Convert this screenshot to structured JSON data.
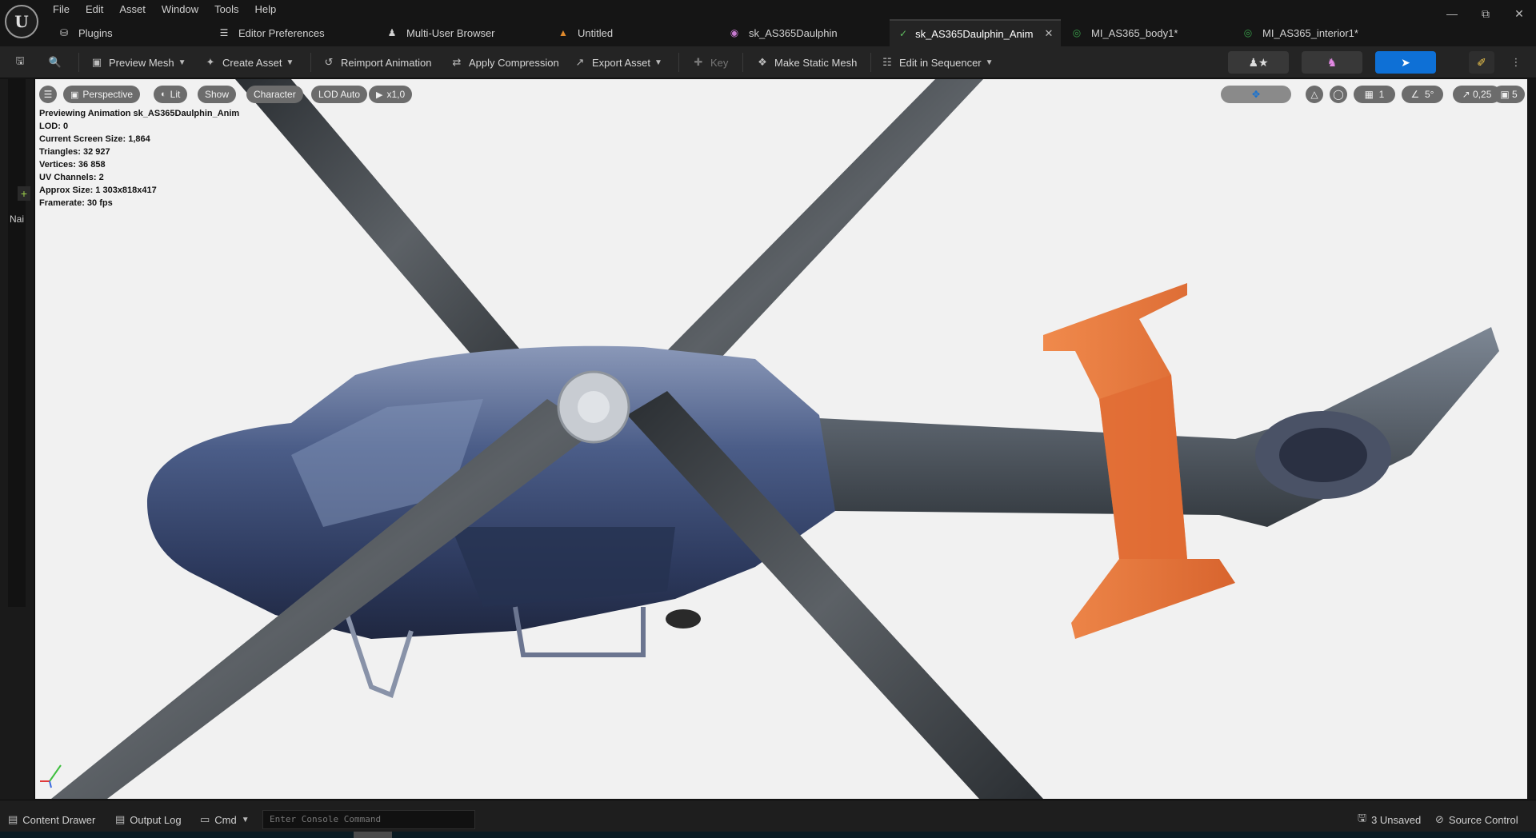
{
  "app": {
    "logo_text": "U",
    "menu": [
      "File",
      "Edit",
      "Asset",
      "Window",
      "Tools",
      "Help"
    ]
  },
  "tabs": [
    {
      "label": "Plugins",
      "icon": "plug-icon"
    },
    {
      "label": "Editor Preferences",
      "icon": "sliders-icon"
    },
    {
      "label": "Multi-User Browser",
      "icon": "users-icon"
    },
    {
      "label": "Untitled",
      "icon": "level-icon"
    },
    {
      "label": "sk_AS365Daulphin",
      "icon": "skeleton-icon"
    },
    {
      "label": "sk_AS365Daulphin_Anim",
      "icon": "animation-icon",
      "active": true
    },
    {
      "label": "MI_AS365_body1*",
      "icon": "material-instance-icon"
    },
    {
      "label": "MI_AS365_interior1*",
      "icon": "material-instance-icon"
    }
  ],
  "toolbar": {
    "preview_mesh": "Preview Mesh",
    "create_asset": "Create Asset",
    "reimport": "Reimport Animation",
    "apply_compression": "Apply Compression",
    "export_asset": "Export Asset",
    "key": "Key",
    "make_static_mesh": "Make Static Mesh",
    "edit_in_sequencer": "Edit in Sequencer"
  },
  "left_panel": {
    "label": "Nai"
  },
  "viewport": {
    "perspective": "Perspective",
    "lit": "Lit",
    "show": "Show",
    "character": "Character",
    "lod": "LOD Auto",
    "speed": "x1,0",
    "grid_value": "1",
    "angle_value": "5°",
    "scale_value": "0,25",
    "camera_speed": "5",
    "stats": [
      "Previewing Animation sk_AS365Daulphin_Anim",
      "LOD: 0",
      "Current Screen Size: 1,864",
      "Triangles: 32 927",
      "Vertices: 36 858",
      "UV Channels: 2",
      "Approx Size: 1 303x818x417",
      "Framerate: 30 fps"
    ]
  },
  "statusbar": {
    "content_drawer": "Content Drawer",
    "output_log": "Output Log",
    "cmd": "Cmd",
    "console_placeholder": "Enter Console Command",
    "unsaved": "3 Unsaved",
    "source_control": "Source Control"
  },
  "colors": {
    "accent": "#0e70d6",
    "tail_stabilizer": "#e8763c",
    "body": "#3c4a6e"
  }
}
